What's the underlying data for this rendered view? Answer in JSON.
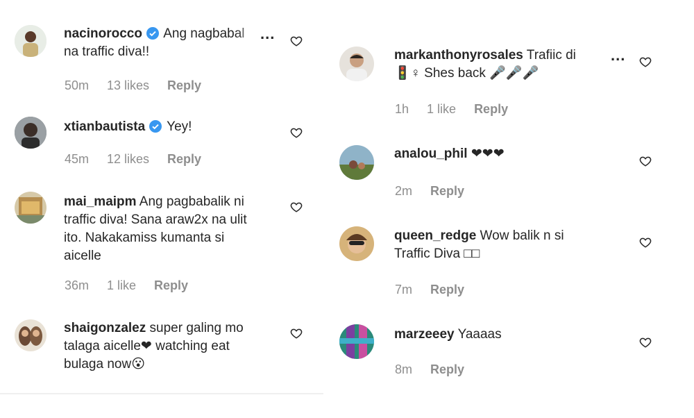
{
  "left": {
    "comments": [
      {
        "username": "nacinorocco",
        "verified": true,
        "line1": "Ang nagbabal",
        "line2": "na traffic diva!!",
        "line3": "",
        "line4": "",
        "time": "50m",
        "likes": "13 likes",
        "reply": "Reply",
        "more": "..."
      },
      {
        "username": "xtianbautista",
        "verified": true,
        "line1": "Yey!",
        "line2": "",
        "line3": "",
        "line4": "",
        "time": "45m",
        "likes": "12 likes",
        "reply": "Reply"
      },
      {
        "username": "mai_maipm",
        "verified": false,
        "line1": "Ang pagbabalik ni",
        "line2": "traffic diva! Sana araw2x na ulit",
        "line3": "ito. Nakakamiss kumanta si",
        "line4": "aicelle",
        "time": "36m",
        "likes": "1 like",
        "reply": "Reply"
      },
      {
        "username": "shaigonzalez",
        "verified": false,
        "line1": "super galing mo",
        "line2": "talaga aicelle❤ watching eat",
        "line3": "bulaga now😮",
        "line4": ""
      }
    ]
  },
  "right": {
    "comments": [
      {
        "username": "markanthonyrosales",
        "line1": "Trafiic di",
        "line2": "🚦♀ Shes back 🎤🎤🎤",
        "time": "1h",
        "likes": "1 like",
        "reply": "Reply",
        "more": "..."
      },
      {
        "username": "analou_phil",
        "line1": "❤❤❤",
        "line2": "",
        "time": "2m",
        "likes": "",
        "reply": "Reply"
      },
      {
        "username": "queen_redge",
        "line1": "Wow balik n si",
        "line2": "Traffic Diva □□",
        "time": "7m",
        "likes": "",
        "reply": "Reply"
      },
      {
        "username": "marzeeey",
        "line1": "Yaaaas",
        "line2": "",
        "time": "8m",
        "likes": "",
        "reply": "Reply"
      }
    ]
  },
  "colors": {
    "text": "#262626",
    "meta": "#8e8e8e",
    "verified": "#3897f0",
    "divider": "#efefef"
  }
}
